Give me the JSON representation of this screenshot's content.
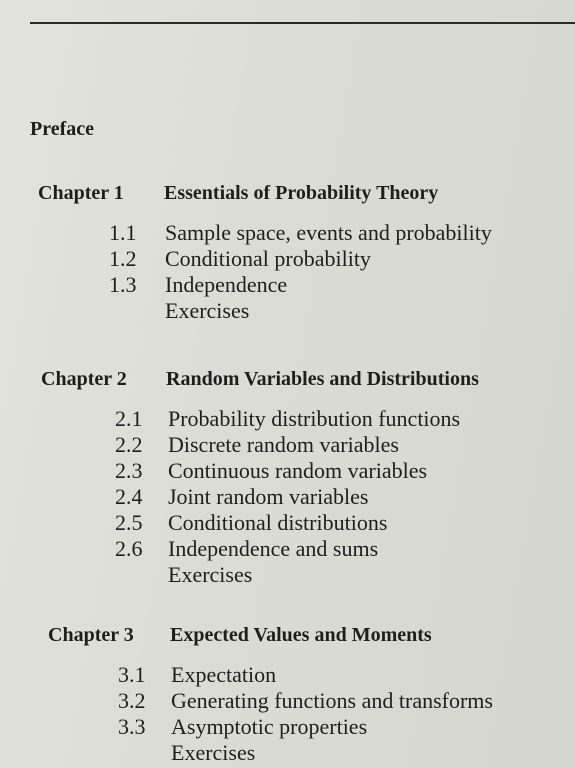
{
  "preface": "Preface",
  "chapters": [
    {
      "label": "Chapter 1",
      "title": "Essentials of Probability Theory",
      "sections": [
        {
          "num": "1.1",
          "title": "Sample space, events and probability"
        },
        {
          "num": "1.2",
          "title": "Conditional probability"
        },
        {
          "num": "1.3",
          "title": "Independence"
        },
        {
          "num": "",
          "title": "Exercises"
        }
      ]
    },
    {
      "label": "Chapter 2",
      "title": "Random Variables and Distributions",
      "sections": [
        {
          "num": "2.1",
          "title": "Probability distribution functions"
        },
        {
          "num": "2.2",
          "title": "Discrete random variables"
        },
        {
          "num": "2.3",
          "title": "Continuous random variables"
        },
        {
          "num": "2.4",
          "title": "Joint random variables"
        },
        {
          "num": "2.5",
          "title": "Conditional distributions"
        },
        {
          "num": "2.6",
          "title": "Independence and sums"
        },
        {
          "num": "",
          "title": "Exercises"
        }
      ]
    },
    {
      "label": "Chapter 3",
      "title": "Expected Values and Moments",
      "sections": [
        {
          "num": "3.1",
          "title": "Expectation"
        },
        {
          "num": "3.2",
          "title": "Generating functions and transforms"
        },
        {
          "num": "3.3",
          "title": "Asymptotic properties"
        },
        {
          "num": "",
          "title": "Exercises"
        }
      ]
    }
  ]
}
